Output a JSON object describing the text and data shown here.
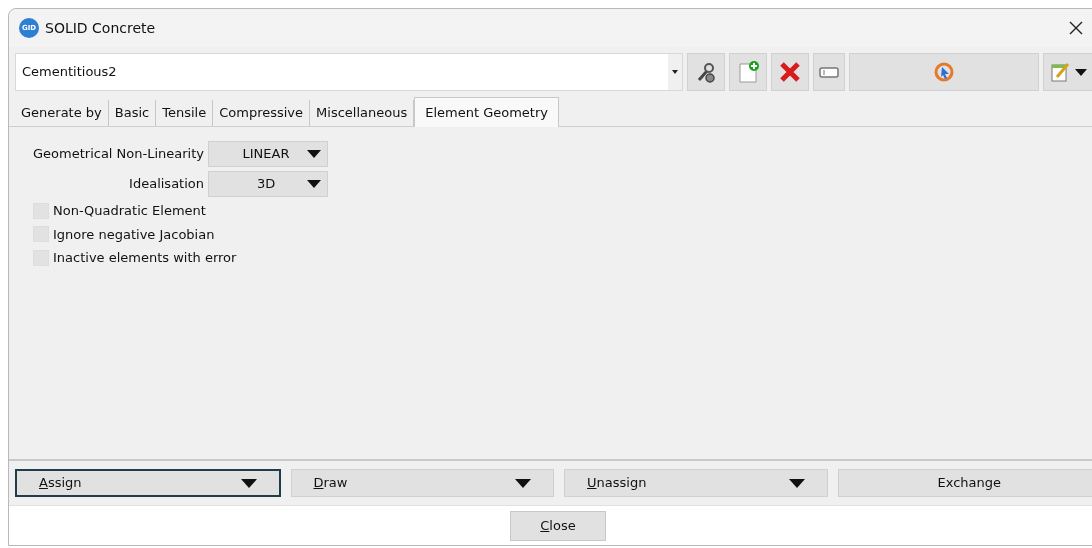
{
  "window": {
    "title": "SOLID Concrete",
    "app_badge": "GID"
  },
  "material": {
    "value": "Cementitious2"
  },
  "toolbar": [
    {
      "kind": "tools"
    },
    {
      "kind": "new"
    },
    {
      "kind": "delete"
    },
    {
      "kind": "rename"
    },
    {
      "kind": "select"
    },
    {
      "kind": "edit"
    }
  ],
  "tabs": [
    {
      "label": "Generate by",
      "selected": false
    },
    {
      "label": "Basic",
      "selected": false
    },
    {
      "label": "Tensile",
      "selected": false
    },
    {
      "label": "Compressive",
      "selected": false
    },
    {
      "label": "Miscellaneous",
      "selected": false
    },
    {
      "label": "Element Geometry",
      "selected": true
    }
  ],
  "fields": [
    {
      "label": "Geometrical Non-Linearity",
      "value": "LINEAR"
    },
    {
      "label": "Idealisation",
      "value": "3D"
    }
  ],
  "checkboxes": [
    {
      "label": "Non-Quadratic Element",
      "checked": false
    },
    {
      "label": "Ignore negative Jacobian",
      "checked": false
    },
    {
      "label": "Inactive elements with error",
      "checked": false
    }
  ],
  "actions": [
    {
      "label": "Assign",
      "mnemonic": true,
      "menu": true,
      "focused": true
    },
    {
      "label": "Draw",
      "mnemonic": true,
      "menu": true,
      "focused": false
    },
    {
      "label": "Unassign",
      "mnemonic": true,
      "menu": true,
      "focused": false
    },
    {
      "label": "Exchange",
      "mnemonic": false,
      "menu": false,
      "focused": false
    }
  ],
  "close_button": {
    "label": "Close",
    "mnemonic": true
  }
}
